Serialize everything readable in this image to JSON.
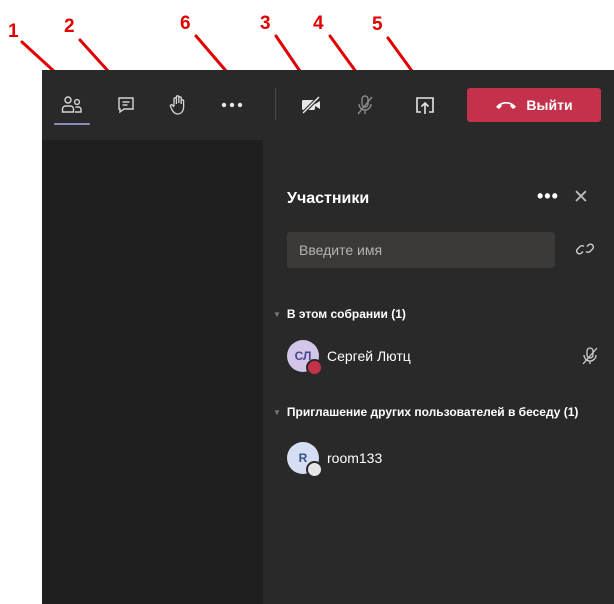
{
  "annotations": [
    "1",
    "2",
    "6",
    "3",
    "4",
    "5"
  ],
  "toolbar": {
    "buttons": [
      {
        "icon": "participants-icon",
        "active": true
      },
      {
        "icon": "chat-icon"
      },
      {
        "icon": "raise-hand-icon"
      },
      {
        "icon": "more-actions-icon"
      },
      {
        "icon": "camera-off-icon"
      },
      {
        "icon": "mic-off-icon"
      },
      {
        "icon": "share-screen-icon"
      }
    ],
    "leave_label": "Выйти",
    "leave_color": "#c4314b"
  },
  "panel": {
    "title": "Участники",
    "more_label": "•••",
    "close_label": "✕",
    "search_placeholder": "Введите имя",
    "sections": [
      {
        "header": "В этом собрании (1)",
        "people": [
          {
            "initials": "СЛ",
            "name": "Сергей Лютц",
            "avatar_color": "#d3c6e9",
            "status_color": "#c4314b",
            "muted": true
          }
        ]
      },
      {
        "header": "Приглашение других пользователей в беседу (1)",
        "people": [
          {
            "initials": "R",
            "name": "room133",
            "avatar_color": "#d5def3",
            "status_color": "#e6e6e6",
            "muted": false
          }
        ]
      }
    ]
  },
  "colors": {
    "toolbar_bg": "#292929",
    "stage_bg": "#1f1f1f",
    "panel_bg": "#292929",
    "accent_underline": "#8b8cc7",
    "annotation_red": "#e00000"
  }
}
